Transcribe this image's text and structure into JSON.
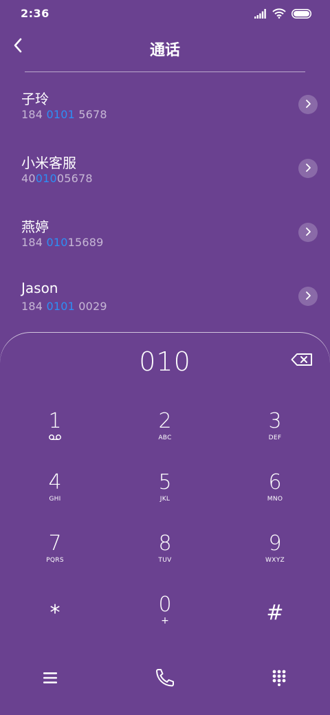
{
  "status_bar": {
    "time": "2:36",
    "icons": [
      "signal-icon",
      "wifi-icon",
      "battery-icon"
    ]
  },
  "header": {
    "title": "通话",
    "back_icon": "back-chevron-icon"
  },
  "search_query": "010",
  "results": [
    {
      "name": "子玲",
      "number_prefix": "184 ",
      "number_match": "0101",
      "number_suffix": " 5678"
    },
    {
      "name": "小米客服",
      "number_prefix": "40",
      "number_match": "010",
      "number_suffix": "05678"
    },
    {
      "name": "燕婷",
      "number_prefix": "184 ",
      "number_match": "010",
      "number_suffix": "15689"
    },
    {
      "name": "Jason",
      "number_prefix": "184 ",
      "number_match": "0101",
      "number_suffix": " 0029"
    }
  ],
  "dialpad": {
    "display": "010",
    "keys": [
      {
        "digit": "1",
        "sub": ""
      },
      {
        "digit": "2",
        "sub": "ABC"
      },
      {
        "digit": "3",
        "sub": "DEF"
      },
      {
        "digit": "4",
        "sub": "GHI"
      },
      {
        "digit": "5",
        "sub": "JKL"
      },
      {
        "digit": "6",
        "sub": "MNO"
      },
      {
        "digit": "7",
        "sub": "PQRS"
      },
      {
        "digit": "8",
        "sub": "TUV"
      },
      {
        "digit": "9",
        "sub": "WXYZ"
      },
      {
        "digit": "*",
        "sub": ""
      },
      {
        "digit": "0",
        "sub": "+"
      },
      {
        "digit": "#",
        "sub": ""
      }
    ]
  },
  "bottom_bar": {
    "icons": [
      "menu-icon",
      "phone-call-icon",
      "dialpad-icon"
    ]
  },
  "colors": {
    "background": "#6a4190",
    "match_highlight": "#2d8ff5",
    "text": "#ffffff"
  }
}
